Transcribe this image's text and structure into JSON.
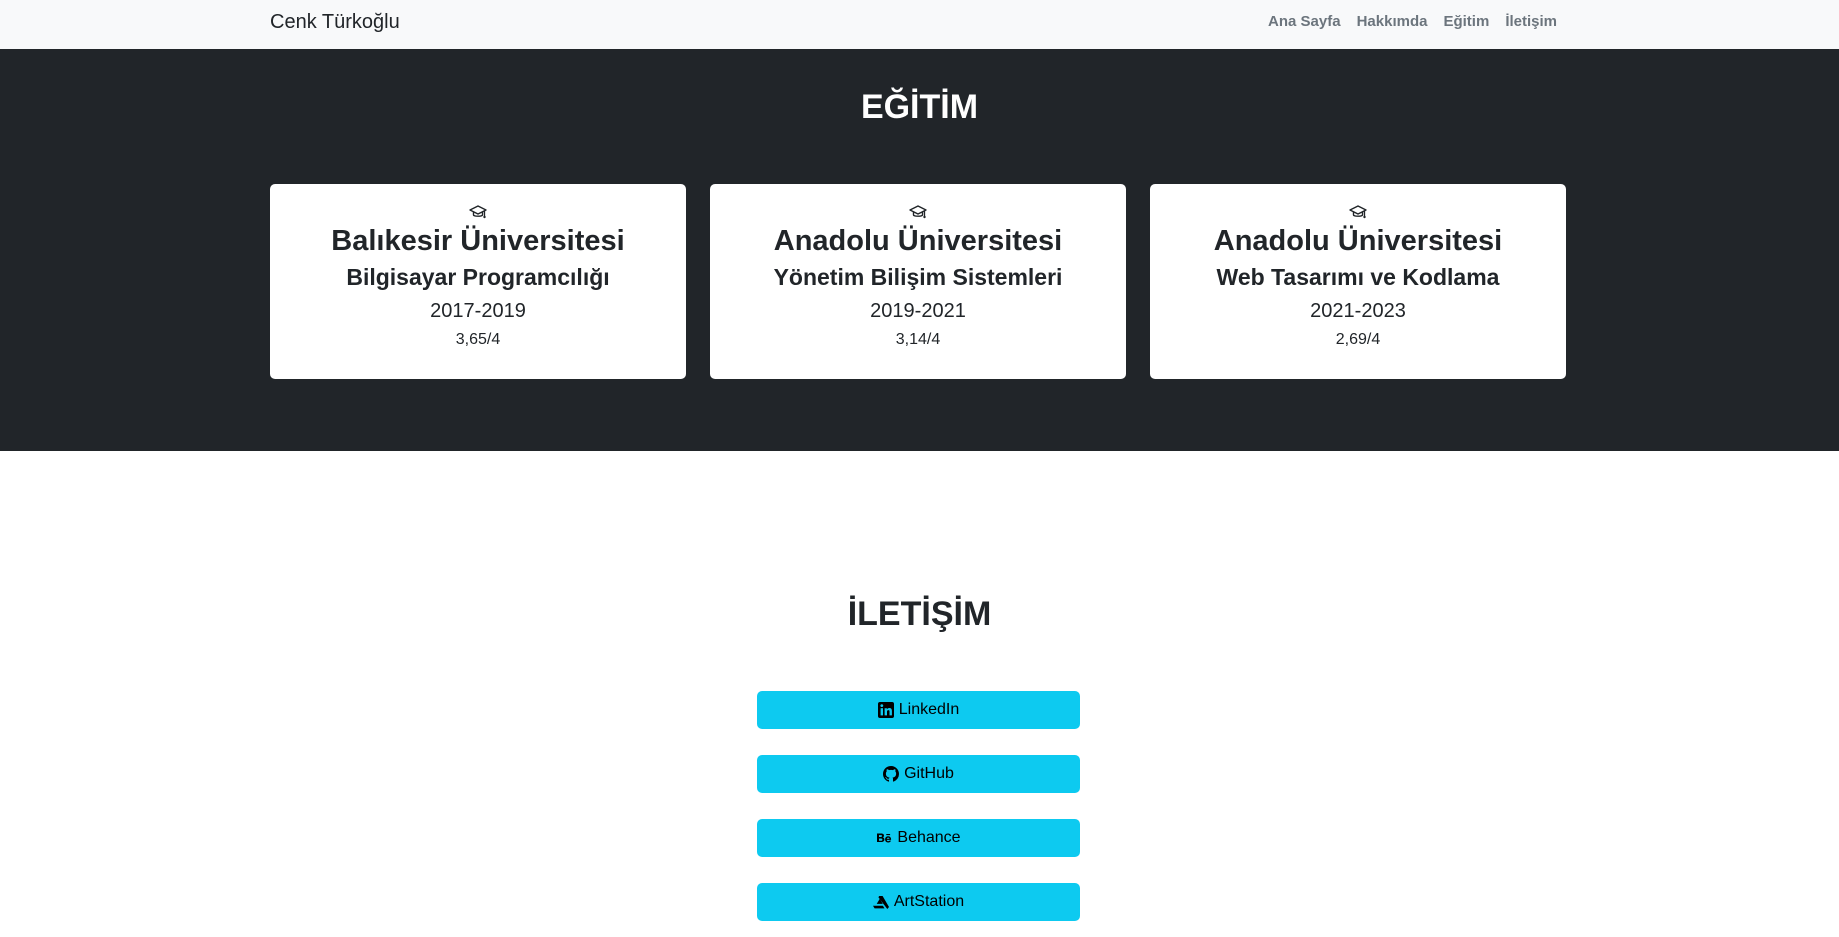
{
  "navbar": {
    "brand": "Cenk Türkoğlu",
    "links": [
      "Ana Sayfa",
      "Hakkımda",
      "Eğitim",
      "İletişim"
    ]
  },
  "education": {
    "title": "EĞİTİM",
    "items": [
      {
        "school": "Balıkesir Üniversitesi",
        "department": "Bilgisayar Programcılığı",
        "years": "2017-2019",
        "gpa": "3,65/4"
      },
      {
        "school": "Anadolu Üniversitesi",
        "department": "Yönetim Bilişim Sistemleri",
        "years": "2019-2021",
        "gpa": "3,14/4"
      },
      {
        "school": "Anadolu Üniversitesi",
        "department": "Web Tasarımı ve Kodlama",
        "years": "2021-2023",
        "gpa": "2,69/4"
      }
    ]
  },
  "contact": {
    "title": "İLETİŞİM",
    "buttons": [
      {
        "label": "LinkedIn",
        "icon": "linkedin-icon"
      },
      {
        "label": "GitHub",
        "icon": "github-icon"
      },
      {
        "label": "Behance",
        "icon": "behance-icon"
      },
      {
        "label": "ArtStation",
        "icon": "artstation-icon"
      }
    ]
  },
  "colors": {
    "navbar_bg": "#f8f9fa",
    "dark_section_bg": "#212529",
    "button_bg": "#0dcaf0"
  }
}
